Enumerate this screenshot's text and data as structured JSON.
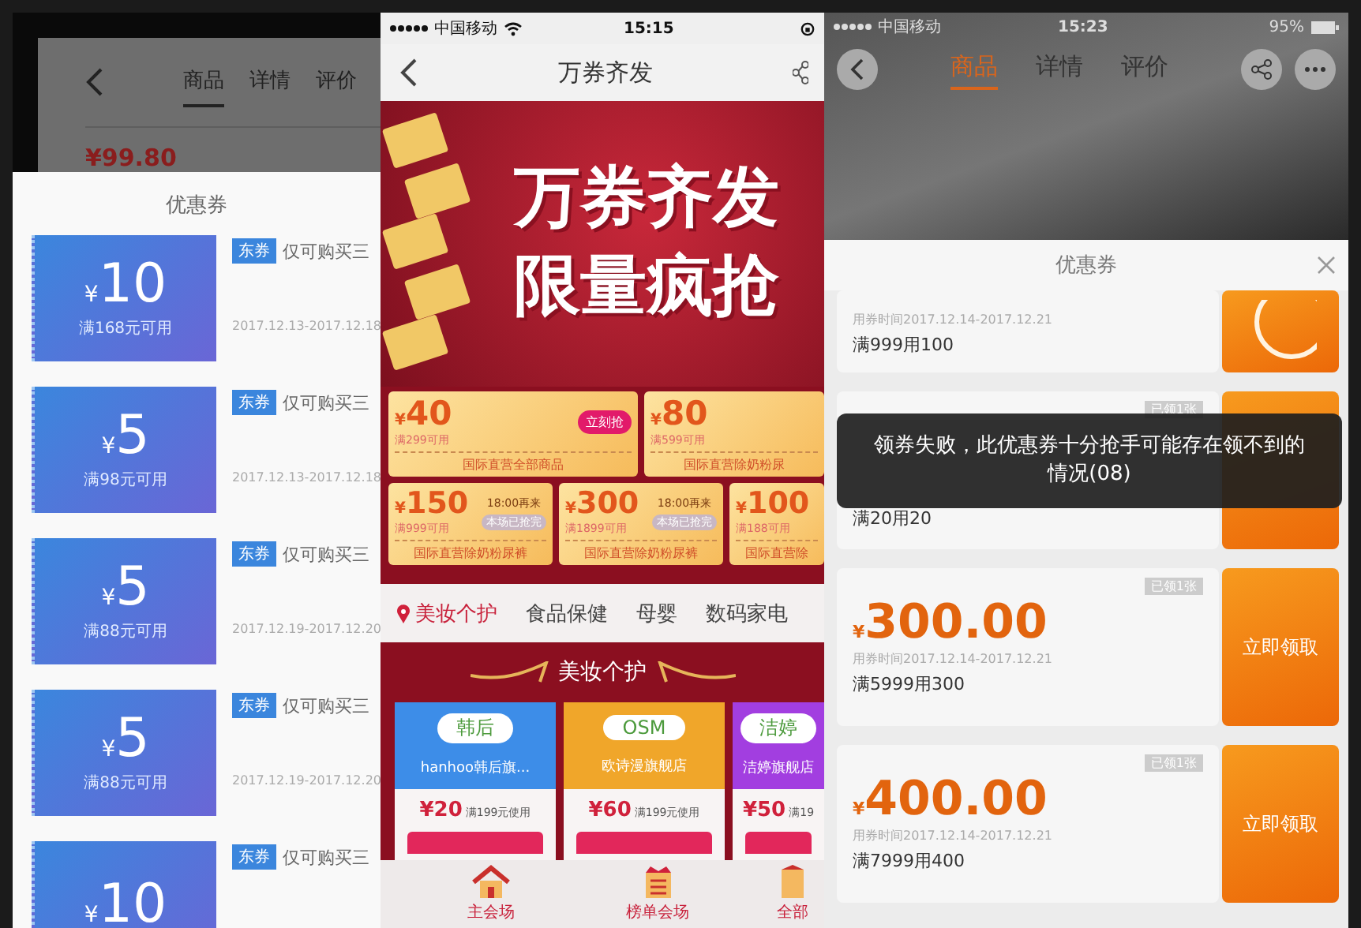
{
  "left_screen": {
    "background_page": {
      "tabs": [
        {
          "label": "商品",
          "selected": true
        },
        {
          "label": "详情",
          "selected": false
        },
        {
          "label": "评价",
          "selected": false
        }
      ],
      "price": "¥99.80"
    },
    "sheet_title": "优惠券",
    "coupons": [
      {
        "currency": "¥",
        "amount": "10",
        "condition": "满168元可用",
        "tag": "东券",
        "description": "仅可购买三",
        "dates": "2017.12.13-2017.12.18"
      },
      {
        "currency": "¥",
        "amount": "5",
        "condition": "满98元可用",
        "tag": "东券",
        "description": "仅可购买三",
        "dates": "2017.12.13-2017.12.18"
      },
      {
        "currency": "¥",
        "amount": "5",
        "condition": "满88元可用",
        "tag": "东券",
        "description": "仅可购买三",
        "dates": "2017.12.19-2017.12.20"
      },
      {
        "currency": "¥",
        "amount": "5",
        "condition": "满88元可用",
        "tag": "东券",
        "description": "仅可购买三",
        "dates": "2017.12.19-2017.12.20"
      },
      {
        "currency": "¥",
        "amount": "10",
        "tag": "东券",
        "description": "仅可购买三"
      }
    ]
  },
  "middle_screen": {
    "status_bar": {
      "carrier": "中国移动",
      "time": "15:15"
    },
    "title": "万券齐发",
    "banner_lines": [
      "万券齐发",
      "限量疯抢"
    ],
    "coupon_rows": [
      [
        {
          "currency": "¥",
          "amount": "40",
          "condition": "满299可用",
          "action": "立刻抢",
          "scope": "国际直营全部商品"
        },
        {
          "currency": "¥",
          "amount": "80",
          "condition": "满599可用",
          "scope": "国际直营除奶粉尿"
        }
      ],
      [
        {
          "currency": "¥",
          "amount": "150",
          "next_round": "18:00再来",
          "status": "本场已抢完",
          "condition": "满999可用",
          "scope": "国际直营除奶粉尿裤"
        },
        {
          "currency": "¥",
          "amount": "300",
          "next_round": "18:00再来",
          "status": "本场已抢完",
          "condition": "满1899可用",
          "scope": "国际直营除奶粉尿裤"
        },
        {
          "currency": "¥",
          "amount": "100",
          "condition": "满188可用",
          "scope": "国际直营除"
        }
      ]
    ],
    "categories": [
      {
        "label": "美妆个护",
        "selected": true
      },
      {
        "label": "食品保健",
        "selected": false
      },
      {
        "label": "母婴",
        "selected": false
      },
      {
        "label": "数码家电",
        "selected": false
      }
    ],
    "section_title": "美妆个护",
    "stores": [
      {
        "logo": "韩后",
        "name": "hanhoo韩后旗...",
        "color": "#3d8de8",
        "currency": "¥",
        "amount": "20",
        "condition": "满199元使用"
      },
      {
        "logo": "OSM",
        "name": "欧诗漫旗舰店",
        "color": "#f0a62a",
        "currency": "¥",
        "amount": "60",
        "condition": "满199元使用"
      },
      {
        "logo": "洁婷",
        "name": "洁婷旗舰店",
        "color": "#a23ee0",
        "currency": "¥",
        "amount": "50",
        "condition": "满19"
      }
    ],
    "tab_bar": [
      {
        "label": "主会场",
        "kind": "home"
      },
      {
        "label": "榜单会场",
        "kind": "list"
      },
      {
        "label": "全部",
        "kind": "more"
      }
    ]
  },
  "right_screen": {
    "status_bar": {
      "carrier": "中国移动",
      "time": "15:23",
      "battery": "95%"
    },
    "tabs": [
      {
        "label": "商品",
        "selected": true
      },
      {
        "label": "详情",
        "selected": false
      },
      {
        "label": "评价",
        "selected": false
      }
    ],
    "sheet_title": "优惠券",
    "coupons": [
      {
        "kind": "claimed",
        "dates": "用券时间2017.12.14-2017.12.21",
        "condition": "满999用100"
      },
      {
        "kind": "covered",
        "badge": "已领1张",
        "condition": "满20用20"
      },
      {
        "kind": "open",
        "badge": "已领1张",
        "currency": "¥",
        "amount": "300.00",
        "dates": "用券时间2017.12.14-2017.12.21",
        "condition": "满5999用300",
        "action": "立即领取"
      },
      {
        "kind": "open",
        "badge": "已领1张",
        "currency": "¥",
        "amount": "400.00",
        "dates": "用券时间2017.12.14-2017.12.21",
        "condition": "满7999用400",
        "action": "立即领取"
      }
    ],
    "toast": "领券失败，此优惠券十分抢手可能存在领不到的情况(08)"
  }
}
